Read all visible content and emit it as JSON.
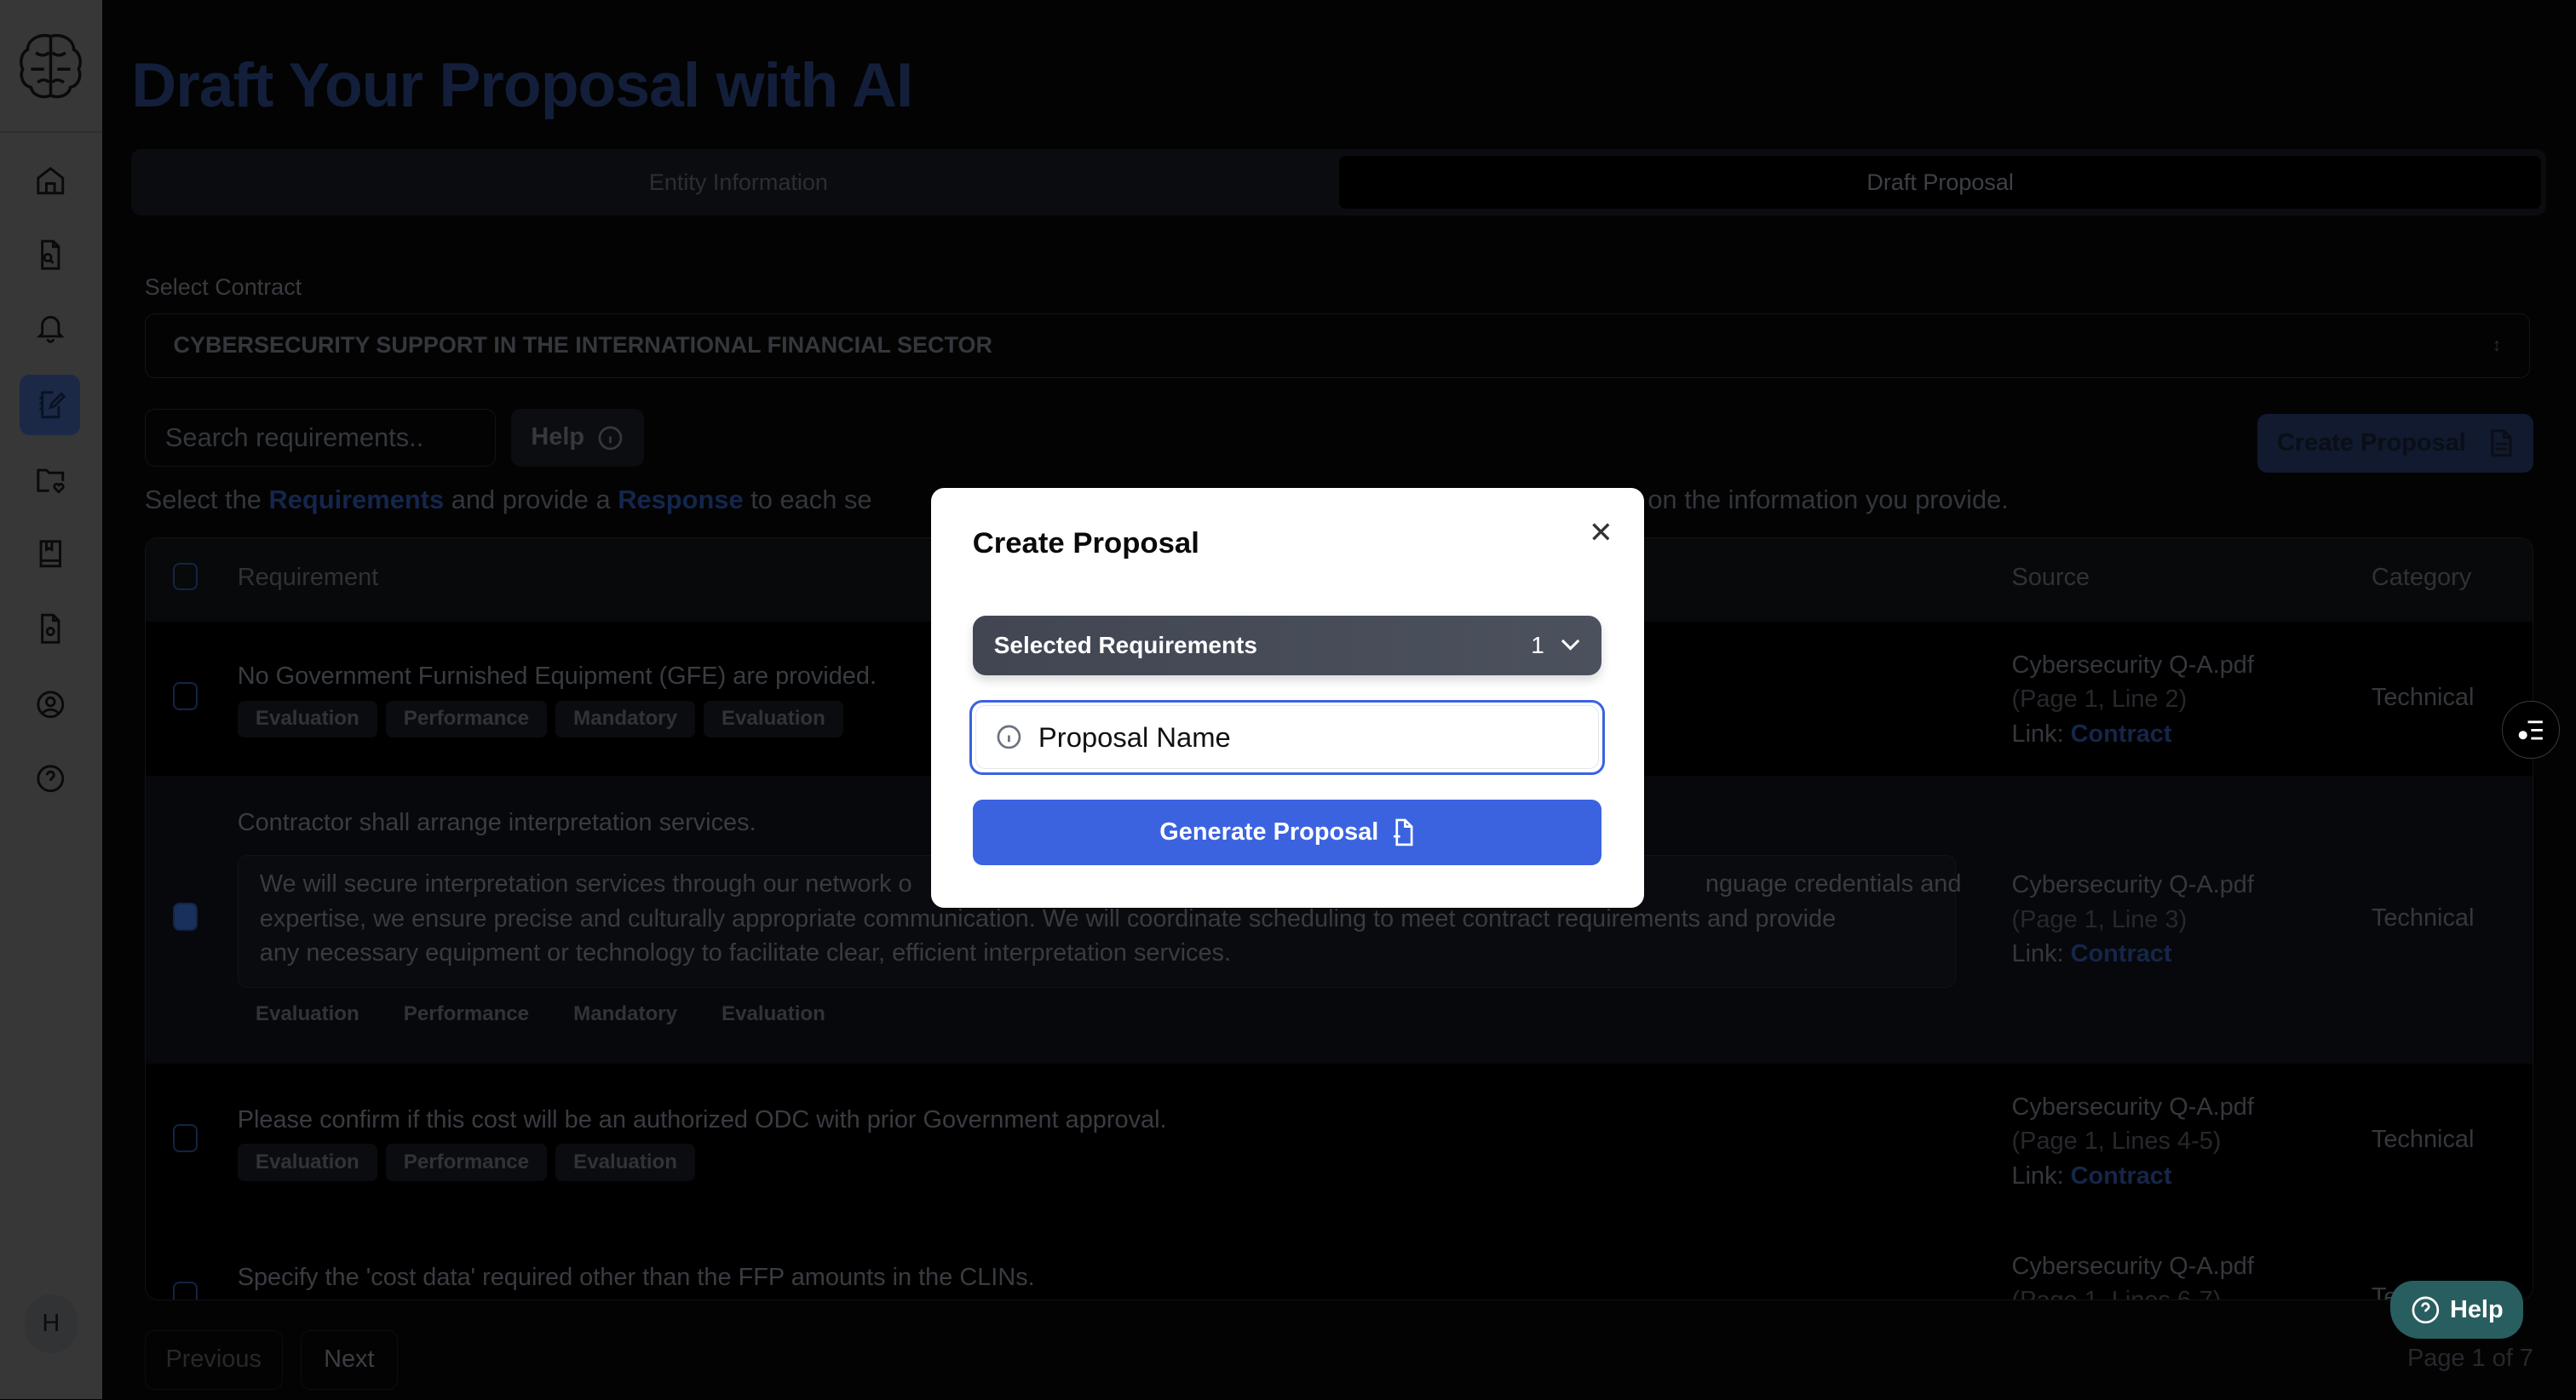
{
  "page": {
    "title": "Draft Your Proposal with AI"
  },
  "sidebar": {
    "items": [
      "home-icon",
      "file-search-icon",
      "bell-icon",
      "notebook-pen-icon",
      "folder-heart-icon",
      "book-icon",
      "file-settings-icon",
      "user-circle-icon",
      "help-circle-icon"
    ],
    "active_index": 3,
    "avatar_initial": "H"
  },
  "tabs": [
    {
      "label": "Entity Information",
      "active": false
    },
    {
      "label": "Draft Proposal",
      "active": true
    }
  ],
  "contract": {
    "label": "Select Contract",
    "value": "CYBERSECURITY SUPPORT IN THE INTERNATIONAL FINANCIAL SECTOR"
  },
  "toolbar": {
    "search_placeholder": "Search requirements..",
    "help_label": "Help",
    "create_label": "Create Proposal"
  },
  "instruction": {
    "part1": "Select the ",
    "req": "Requirements",
    "part2": " and provide a ",
    "resp": "Response",
    "part3": " to each se",
    "part4": "on the information you provide."
  },
  "table": {
    "headers": {
      "requirement": "Requirement",
      "source": "Source",
      "category": "Category"
    },
    "rows": [
      {
        "checked": false,
        "text": "No Government Furnished Equipment (GFE) are provided.",
        "tags": [
          "Evaluation",
          "Performance",
          "Mandatory",
          "Evaluation"
        ],
        "source": "Cybersecurity Q-A.pdf",
        "pages": "(Page 1, Line 2)",
        "link_prefix": "Link:",
        "link": "Contract",
        "category": "Technical"
      },
      {
        "checked": true,
        "text": "Contractor shall arrange interpretation services.",
        "response_l1a": "We will secure interpretation services through our network o",
        "response_l1b": "nguage credentials and",
        "response_l2": "expertise, we ensure precise and culturally appropriate communication. We will coordinate scheduling to meet contract requirements and provide",
        "response_l3": "any necessary equipment or technology to facilitate clear, efficient interpretation services.",
        "tags": [
          "Evaluation",
          "Performance",
          "Mandatory",
          "Evaluation"
        ],
        "source": "Cybersecurity Q-A.pdf",
        "pages": "(Page 1, Line 3)",
        "link_prefix": "Link:",
        "link": "Contract",
        "category": "Technical"
      },
      {
        "checked": false,
        "text": "Please confirm if this cost will be an authorized ODC with prior Government approval.",
        "tags": [
          "Evaluation",
          "Performance",
          "Evaluation"
        ],
        "source": "Cybersecurity Q-A.pdf",
        "pages": "(Page 1, Lines 4-5)",
        "link_prefix": "Link:",
        "link": "Contract",
        "category": "Technical"
      },
      {
        "checked": false,
        "text": "Specify the 'cost data' required other than the FFP amounts in the CLINs.",
        "source": "Cybersecurity Q-A.pdf",
        "pages": "(Page 1, Lines 6-7)",
        "category": "Te"
      }
    ]
  },
  "pagination": {
    "previous": "Previous",
    "next": "Next",
    "status": "Page 1 of 7"
  },
  "help_fab": {
    "label": "Help"
  },
  "modal": {
    "title": "Create Proposal",
    "selected_label": "Selected Requirements",
    "selected_count": "1",
    "name_value": "Proposal Name",
    "generate_label": "Generate Proposal"
  },
  "colors": {
    "accent": "#3b63e0",
    "help_fab": "#295e60",
    "selected_bar": "#454b57"
  }
}
